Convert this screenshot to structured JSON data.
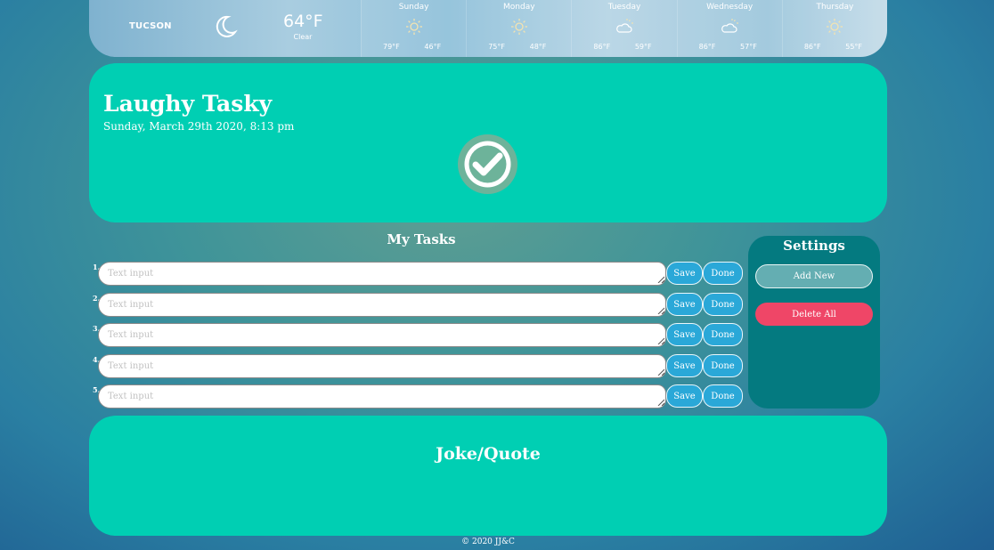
{
  "weather": {
    "city": "TUCSON",
    "current_icon": "moon-icon",
    "temperature": "64°F",
    "condition": "Clear",
    "forecast": [
      {
        "day": "Sunday",
        "icon": "sun-icon",
        "high": "79°F",
        "low": "46°F"
      },
      {
        "day": "Monday",
        "icon": "sun-icon",
        "high": "75°F",
        "low": "48°F"
      },
      {
        "day": "Tuesday",
        "icon": "partly-cloudy-icon",
        "high": "86°F",
        "low": "59°F"
      },
      {
        "day": "Wednesday",
        "icon": "partly-cloudy-icon",
        "high": "86°F",
        "low": "57°F"
      },
      {
        "day": "Thursday",
        "icon": "sun-icon",
        "high": "86°F",
        "low": "55°F"
      }
    ]
  },
  "header": {
    "title": "Laughy Tasky",
    "date": "Sunday, March 29th 2020, 8:13 pm",
    "logo_icon": "checkmark-circle-icon"
  },
  "tasks": {
    "title": "My Tasks",
    "items": [
      {
        "number": "1.",
        "placeholder": "Text input",
        "value": "",
        "save_label": "Save",
        "done_label": "Done"
      },
      {
        "number": "2.",
        "placeholder": "Text input",
        "value": "",
        "save_label": "Save",
        "done_label": "Done"
      },
      {
        "number": "3.",
        "placeholder": "Text input",
        "value": "",
        "save_label": "Save",
        "done_label": "Done"
      },
      {
        "number": "4.",
        "placeholder": "Text input",
        "value": "",
        "save_label": "Save",
        "done_label": "Done"
      },
      {
        "number": "5.",
        "placeholder": "Text input",
        "value": "",
        "save_label": "Save",
        "done_label": "Done"
      }
    ]
  },
  "settings": {
    "title": "Settings",
    "add_label": "Add New",
    "delete_label": "Delete All"
  },
  "joke": {
    "title": "Joke/Quote"
  },
  "footer": {
    "text": "© 2020 JJ&C"
  },
  "colors": {
    "card": "#00cfb3",
    "settings_panel": "#047a80",
    "button_blue": "#2aa8d8",
    "button_add": "#64aeb2",
    "button_delete": "#ef4667"
  }
}
